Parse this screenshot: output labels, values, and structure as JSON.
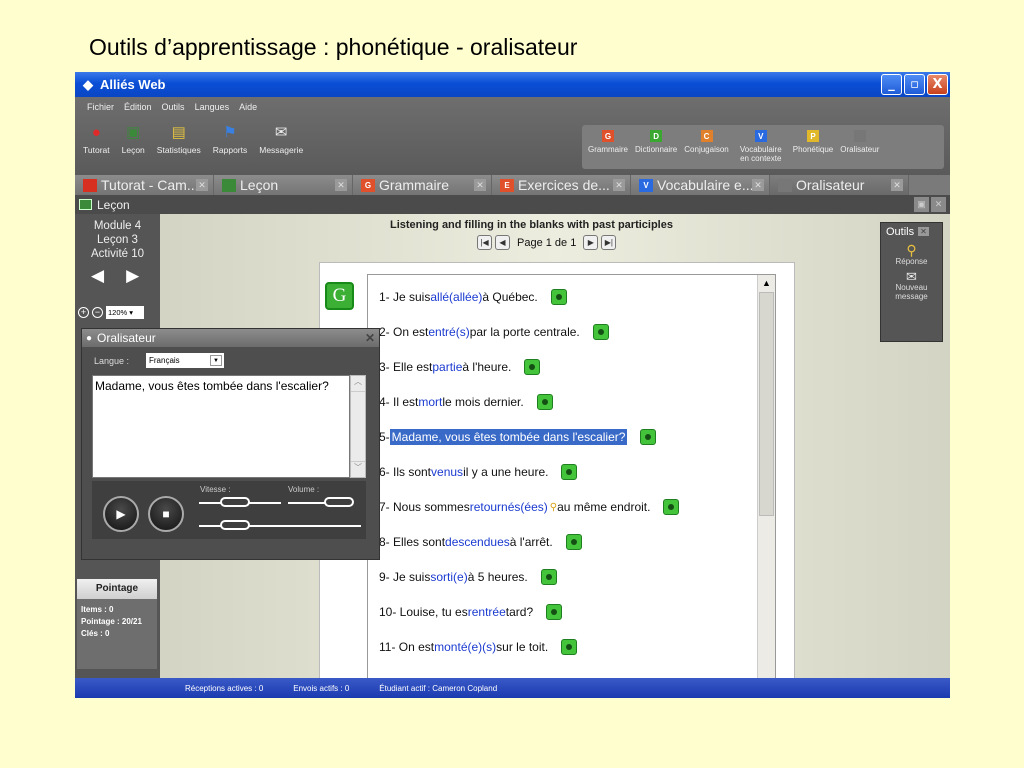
{
  "slide": {
    "title": "Outils d’apprentissage : phonétique - oralisateur"
  },
  "window": {
    "title": "Alliés Web",
    "min": "_",
    "max": "▫",
    "close": "X"
  },
  "menu": [
    "Fichier",
    "Édition",
    "Outils",
    "Langues",
    "Aide"
  ],
  "tools_left": [
    {
      "label": "Tutorat",
      "icon": "apple-icon"
    },
    {
      "label": "Leçon",
      "icon": "board-icon"
    },
    {
      "label": "Statistiques",
      "icon": "chart-icon"
    },
    {
      "label": "Rapports",
      "icon": "flag-icon"
    },
    {
      "label": "Messagerie",
      "icon": "mail-icon"
    }
  ],
  "tools_right": [
    {
      "label": "Grammaire",
      "letter": "G",
      "color": "#e0502a"
    },
    {
      "label": "Dictionnaire",
      "letter": "D",
      "color": "#3aa830"
    },
    {
      "label": "Conjugaison",
      "letter": "C",
      "color": "#e0802a"
    },
    {
      "label": "Vocabulaire en contexte",
      "letter": "V",
      "color": "#2a6ae0"
    },
    {
      "label": "Phonétique",
      "letter": "P",
      "color": "#e0b82a"
    },
    {
      "label": "Oralisateur",
      "letter": "",
      "color": "#777777"
    }
  ],
  "tabs": [
    {
      "label": "Tutorat - Cam...",
      "letter": "",
      "color": "#d83020"
    },
    {
      "label": "Leçon",
      "letter": "",
      "color": "#3a8a3a"
    },
    {
      "label": "Grammaire",
      "letter": "G",
      "color": "#e0502a"
    },
    {
      "label": "Exercices de...",
      "letter": "E",
      "color": "#e0502a"
    },
    {
      "label": "Vocabulaire e...",
      "letter": "V",
      "color": "#2a6ae0"
    },
    {
      "label": "Oralisateur",
      "letter": "",
      "color": "#777777"
    }
  ],
  "lecon_bar": {
    "title": "Leçon"
  },
  "left": {
    "module": "Module 4",
    "lecon": "Leçon 3",
    "activite": "Activité 10",
    "zoom": "120%",
    "pointage": {
      "title": "Pointage",
      "items": "Items : 0",
      "pointage": "Pointage : 20/21",
      "cles": "Clés : 0"
    }
  },
  "main": {
    "title": "Listening and filling in the blanks with past participles",
    "page": "Page 1 de 1",
    "badge": "G",
    "items": [
      {
        "pre": "1- Je suis ",
        "ans": "allé(allée)",
        "post": " à Québec.",
        "key": false
      },
      {
        "pre": "2- On est ",
        "ans": "entré(s)",
        "post": " par la porte centrale.",
        "key": false
      },
      {
        "pre": "3- Elle est ",
        "ans": "partie",
        "post": " à l'heure.",
        "key": false
      },
      {
        "pre": "4- Il est ",
        "ans": "mort",
        "post": " le mois dernier.",
        "key": false
      },
      {
        "pre": "5- ",
        "ans": "",
        "post": "",
        "highlight": "Madame, vous êtes tombée dans l'escalier?",
        "key": false
      },
      {
        "pre": "6- Ils sont ",
        "ans": "venus",
        "post": " il y a une heure.",
        "key": false
      },
      {
        "pre": "7- Nous sommes ",
        "ans": "retournés(ées)",
        "post": " au même endroit.",
        "key": true
      },
      {
        "pre": "8- Elles sont ",
        "ans": "descendues",
        "post": " à l'arrêt.",
        "key": false
      },
      {
        "pre": "9- Je suis ",
        "ans": "sorti(e)",
        "post": " à 5 heures.",
        "key": false
      },
      {
        "pre": "10- Louise, tu es ",
        "ans": "rentrée",
        "post": " tard?",
        "key": false
      },
      {
        "pre": "11- On est ",
        "ans": "monté(e)(s)",
        "post": " sur le toit.",
        "key": false
      }
    ]
  },
  "outils": {
    "title": "Outils",
    "reponse": "Réponse",
    "nouveau": "Nouveau message"
  },
  "oral": {
    "title": "Oralisateur",
    "langue_label": "Langue :",
    "langue": "Français",
    "text": "Madame, vous êtes tombée dans l'escalier?",
    "vitesse": "Vitesse :",
    "volume": "Volume :"
  },
  "status": {
    "receptions": "Réceptions actives : 0",
    "envois": "Envois actifs : 0",
    "etudiant": "Étudiant actif : Cameron Copland"
  }
}
